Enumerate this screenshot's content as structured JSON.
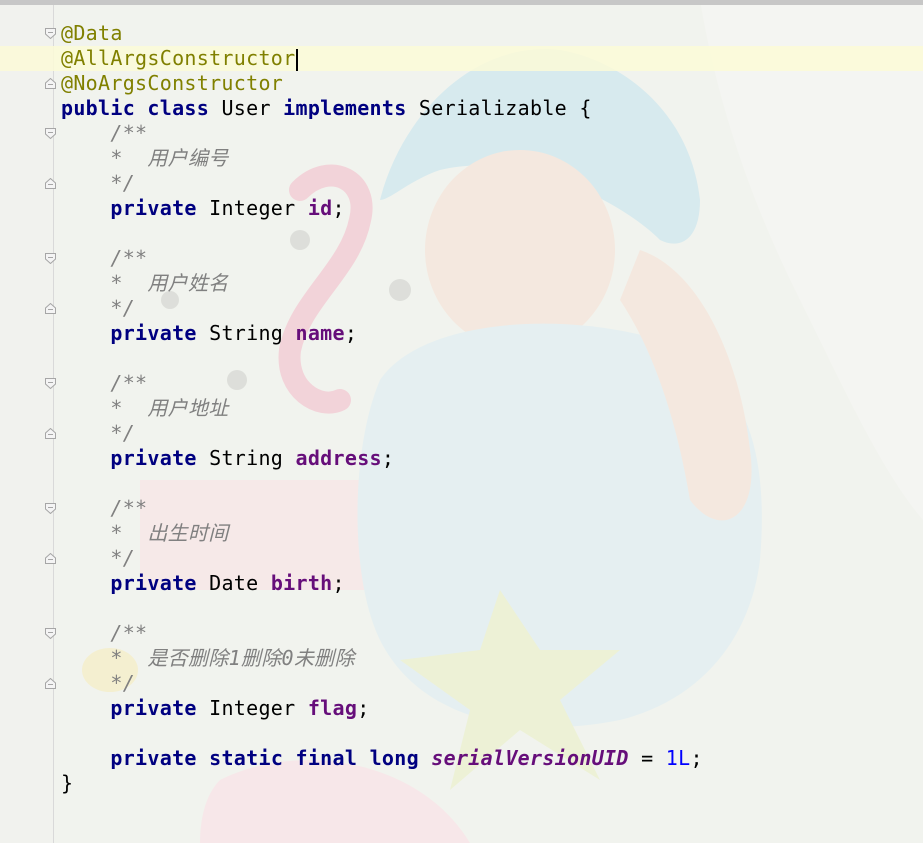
{
  "editor": {
    "language": "java",
    "current_line": 2,
    "colors": {
      "keyword": "#000080",
      "annotation": "#808000",
      "field": "#660e7a",
      "number": "#0000ff",
      "comment": "#808080",
      "current_line_bg": "#fcfad7"
    },
    "lines": [
      {
        "fold": "open",
        "tokens": [
          {
            "t": "@Data",
            "c": "ann"
          }
        ]
      },
      {
        "fold": "none",
        "caret": true,
        "tokens": [
          {
            "t": "@AllArgsConstructor",
            "c": "ann"
          }
        ]
      },
      {
        "fold": "close",
        "tokens": [
          {
            "t": "@NoArgsConstructor",
            "c": "ann"
          }
        ]
      },
      {
        "fold": "none",
        "tokens": [
          {
            "t": "public",
            "c": "kw"
          },
          {
            "t": " "
          },
          {
            "t": "class",
            "c": "kw"
          },
          {
            "t": " User "
          },
          {
            "t": "implements",
            "c": "kw"
          },
          {
            "t": " Serializable {"
          }
        ]
      },
      {
        "fold": "open",
        "tokens": [
          {
            "t": "    /**",
            "c": "cmt"
          }
        ]
      },
      {
        "fold": "none",
        "tokens": [
          {
            "t": "    *  用户编号",
            "c": "cmt"
          }
        ]
      },
      {
        "fold": "close",
        "tokens": [
          {
            "t": "    */",
            "c": "cmt"
          }
        ]
      },
      {
        "fold": "none",
        "tokens": [
          {
            "t": "    "
          },
          {
            "t": "private",
            "c": "kw"
          },
          {
            "t": " Integer "
          },
          {
            "t": "id",
            "c": "fld"
          },
          {
            "t": ";"
          }
        ]
      },
      {
        "fold": "none",
        "tokens": []
      },
      {
        "fold": "open",
        "tokens": [
          {
            "t": "    /**",
            "c": "cmt"
          }
        ]
      },
      {
        "fold": "none",
        "tokens": [
          {
            "t": "    *  用户姓名",
            "c": "cmt"
          }
        ]
      },
      {
        "fold": "close",
        "tokens": [
          {
            "t": "    */",
            "c": "cmt"
          }
        ]
      },
      {
        "fold": "none",
        "tokens": [
          {
            "t": "    "
          },
          {
            "t": "private",
            "c": "kw"
          },
          {
            "t": " String "
          },
          {
            "t": "name",
            "c": "fld"
          },
          {
            "t": ";"
          }
        ]
      },
      {
        "fold": "none",
        "tokens": []
      },
      {
        "fold": "open",
        "tokens": [
          {
            "t": "    /**",
            "c": "cmt"
          }
        ]
      },
      {
        "fold": "none",
        "tokens": [
          {
            "t": "    *  用户地址",
            "c": "cmt"
          }
        ]
      },
      {
        "fold": "close",
        "tokens": [
          {
            "t": "    */",
            "c": "cmt"
          }
        ]
      },
      {
        "fold": "none",
        "tokens": [
          {
            "t": "    "
          },
          {
            "t": "private",
            "c": "kw"
          },
          {
            "t": " String "
          },
          {
            "t": "address",
            "c": "fld"
          },
          {
            "t": ";"
          }
        ]
      },
      {
        "fold": "none",
        "tokens": []
      },
      {
        "fold": "open",
        "tokens": [
          {
            "t": "    /**",
            "c": "cmt"
          }
        ]
      },
      {
        "fold": "none",
        "tokens": [
          {
            "t": "    *  出生时间",
            "c": "cmt"
          }
        ]
      },
      {
        "fold": "close",
        "tokens": [
          {
            "t": "    */",
            "c": "cmt"
          }
        ]
      },
      {
        "fold": "none",
        "tokens": [
          {
            "t": "    "
          },
          {
            "t": "private",
            "c": "kw"
          },
          {
            "t": " Date "
          },
          {
            "t": "birth",
            "c": "fld"
          },
          {
            "t": ";"
          }
        ]
      },
      {
        "fold": "none",
        "tokens": []
      },
      {
        "fold": "open",
        "tokens": [
          {
            "t": "    /**",
            "c": "cmt"
          }
        ]
      },
      {
        "fold": "none",
        "tokens": [
          {
            "t": "    *  是否删除1删除0未删除",
            "c": "cmt"
          }
        ]
      },
      {
        "fold": "close",
        "tokens": [
          {
            "t": "    */",
            "c": "cmt"
          }
        ]
      },
      {
        "fold": "none",
        "tokens": [
          {
            "t": "    "
          },
          {
            "t": "private",
            "c": "kw"
          },
          {
            "t": " Integer "
          },
          {
            "t": "flag",
            "c": "fld"
          },
          {
            "t": ";"
          }
        ]
      },
      {
        "fold": "none",
        "tokens": []
      },
      {
        "fold": "none",
        "tokens": [
          {
            "t": "    "
          },
          {
            "t": "private",
            "c": "kw"
          },
          {
            "t": " "
          },
          {
            "t": "static",
            "c": "kw"
          },
          {
            "t": " "
          },
          {
            "t": "final",
            "c": "kw"
          },
          {
            "t": " "
          },
          {
            "t": "long",
            "c": "kw"
          },
          {
            "t": " "
          },
          {
            "t": "serialVersionUID",
            "c": "sfld"
          },
          {
            "t": " = "
          },
          {
            "t": "1L",
            "c": "num"
          },
          {
            "t": ";"
          }
        ]
      },
      {
        "fold": "none",
        "tokens": [
          {
            "t": "}"
          }
        ]
      }
    ]
  }
}
